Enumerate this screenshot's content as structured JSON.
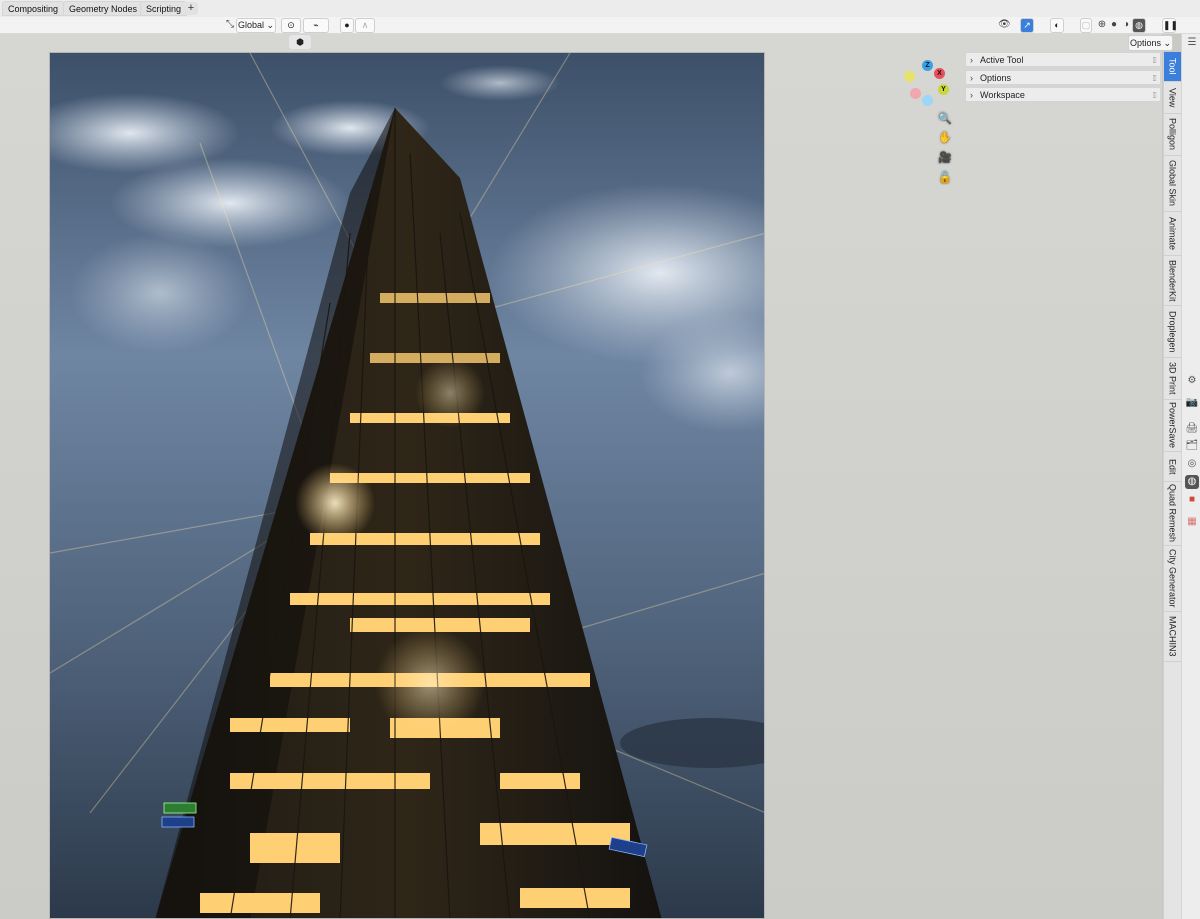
{
  "workspace_tabs": [
    {
      "label": "Compositing"
    },
    {
      "label": "Geometry Nodes"
    },
    {
      "label": "Scripting"
    }
  ],
  "add_tab_label": "+",
  "header": {
    "transform_orientation": "Global",
    "options_label": "Options"
  },
  "npanel": {
    "sections": [
      {
        "label": "Active Tool"
      },
      {
        "label": "Options"
      },
      {
        "label": "Workspace"
      }
    ]
  },
  "sidebar_tabs": [
    {
      "label": "Tool",
      "active": true
    },
    {
      "label": "View"
    },
    {
      "label": "Polligon"
    },
    {
      "label": "Global Skin"
    },
    {
      "label": "Animate"
    },
    {
      "label": "BlenderKit"
    },
    {
      "label": "Droplegen"
    },
    {
      "label": "3D Print"
    },
    {
      "label": "PowerSave"
    },
    {
      "label": "Edit"
    },
    {
      "label": "Quad Remesh"
    },
    {
      "label": "City Generator"
    },
    {
      "label": "MACHIN3"
    }
  ],
  "gizmo": {
    "x": "X",
    "y": "Y",
    "z": "Z",
    "colors": {
      "x": "#e84f5c",
      "y": "#c9d63c",
      "z": "#3aa1e6"
    }
  },
  "colors": {
    "accent": "#3b7fdc",
    "sky_top": "#3c4e66",
    "sky_mid": "#7d92ad",
    "window_glow": "#ffcf73"
  },
  "icons": {
    "zoom": "zoom-icon",
    "pan": "hand-pan-icon",
    "camera": "camera-icon",
    "lock": "lock-icon"
  }
}
